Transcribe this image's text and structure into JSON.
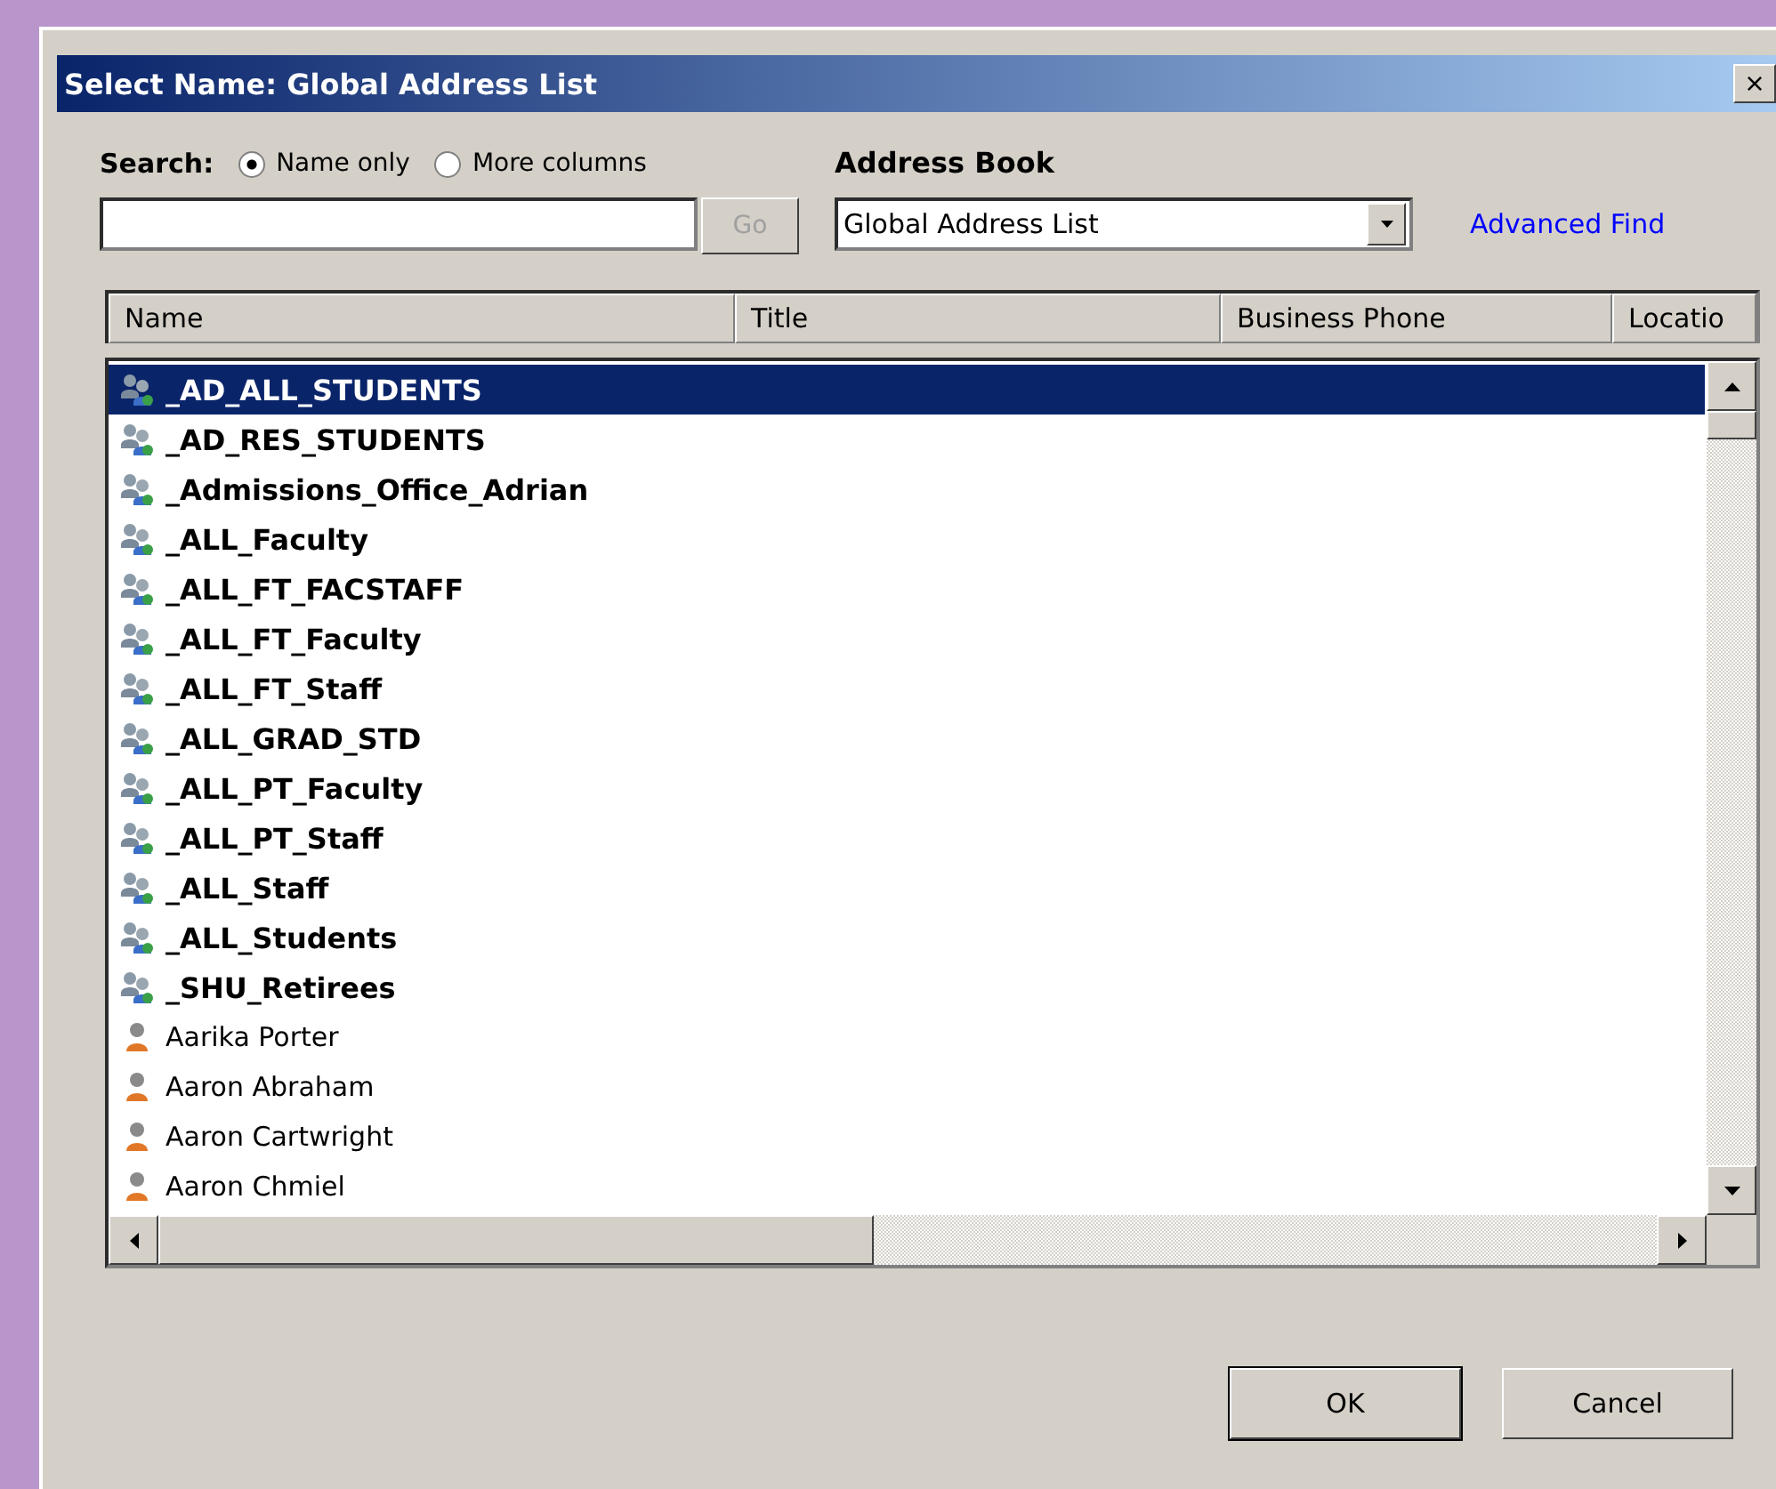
{
  "window": {
    "title": "Select Name: Global Address List",
    "close": "×"
  },
  "search": {
    "label": "Search:",
    "options": [
      {
        "label": "Name only",
        "selected": true
      },
      {
        "label": "More columns",
        "selected": false
      }
    ],
    "go": "Go"
  },
  "address_book": {
    "label": "Address Book",
    "value": "Global Address List",
    "advanced_find": "Advanced Find"
  },
  "table": {
    "columns": [
      "Name",
      "Title",
      "Business Phone",
      "Locatio"
    ],
    "rows": [
      {
        "name": "_AD_ALL_STUDENTS",
        "kind": "group",
        "selected": true
      },
      {
        "name": "_AD_RES_STUDENTS",
        "kind": "group",
        "selected": false
      },
      {
        "name": "_Admissions_Office_Adrian",
        "kind": "group",
        "selected": false
      },
      {
        "name": "_ALL_Faculty",
        "kind": "group",
        "selected": false
      },
      {
        "name": "_ALL_FT_FACSTAFF",
        "kind": "group",
        "selected": false
      },
      {
        "name": "_ALL_FT_Faculty",
        "kind": "group",
        "selected": false
      },
      {
        "name": "_ALL_FT_Staff",
        "kind": "group",
        "selected": false
      },
      {
        "name": "_ALL_GRAD_STD",
        "kind": "group",
        "selected": false
      },
      {
        "name": "_ALL_PT_Faculty",
        "kind": "group",
        "selected": false
      },
      {
        "name": "_ALL_PT_Staff",
        "kind": "group",
        "selected": false
      },
      {
        "name": "_ALL_Staff",
        "kind": "group",
        "selected": false
      },
      {
        "name": "_ALL_Students",
        "kind": "group",
        "selected": false
      },
      {
        "name": "_SHU_Retirees",
        "kind": "group",
        "selected": false
      },
      {
        "name": "Aarika Porter",
        "kind": "person",
        "selected": false
      },
      {
        "name": "Aaron Abraham",
        "kind": "person",
        "selected": false
      },
      {
        "name": "Aaron Cartwright",
        "kind": "person",
        "selected": false
      },
      {
        "name": "Aaron Chmiel",
        "kind": "person",
        "selected": false
      }
    ]
  },
  "buttons": [
    "OK",
    "Cancel"
  ]
}
